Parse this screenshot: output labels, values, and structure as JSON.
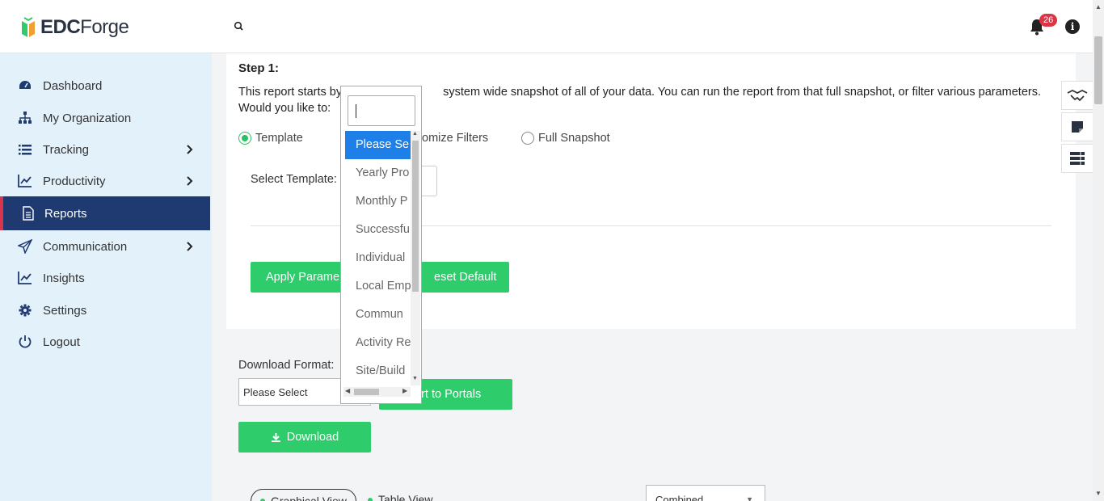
{
  "header": {
    "logo": {
      "part1": "EDC",
      "part2": "Forge"
    },
    "notification_count": "26",
    "info_glyph": "i"
  },
  "sidebar": {
    "items": [
      {
        "label": "Dashboard",
        "icon": "dashboard-icon"
      },
      {
        "label": "My Organization",
        "icon": "sitemap-icon"
      },
      {
        "label": "Tracking",
        "icon": "list-icon",
        "has_submenu": true
      },
      {
        "label": "Productivity",
        "icon": "line-chart-icon",
        "has_submenu": true
      },
      {
        "label": "Reports",
        "icon": "document-icon",
        "active": true
      },
      {
        "label": "Communication",
        "icon": "paper-plane-icon",
        "has_submenu": true
      },
      {
        "label": "Insights",
        "icon": "line-chart-icon"
      },
      {
        "label": "Settings",
        "icon": "gear-icon"
      },
      {
        "label": "Logout",
        "icon": "power-icon"
      }
    ]
  },
  "step": {
    "title": "Step 1:",
    "description_before": "This report starts by",
    "description_after": "system wide snapshot of all of your data. You can run the report from that full snapshot, or filter various parameters.",
    "description_line2": "Would you like to:",
    "options": {
      "template": "Template",
      "customize": "omize Filters",
      "full_snapshot": "Full Snapshot"
    },
    "selected_option": "Template",
    "select_template_label": "Select Template:",
    "apply_button": "Apply Parame",
    "reset_button": "eset Default"
  },
  "download": {
    "format_label": "Download Format:",
    "format_value": "Please Select",
    "export_button": "ort to Portals",
    "download_button": "Download"
  },
  "views": {
    "graphical": "Graphical View",
    "table": "Table View",
    "combined": "Combined"
  },
  "dropdown": {
    "search_value": "",
    "options": [
      {
        "label": "Please Se",
        "selected": true
      },
      {
        "label": "Yearly Pro"
      },
      {
        "label": "Monthly P"
      },
      {
        "label": "Successfu"
      },
      {
        "label": "Individual"
      },
      {
        "label": "Local Emp"
      },
      {
        "label": "Commun"
      },
      {
        "label": "Activity Re"
      },
      {
        "label": "Site/Build"
      }
    ]
  },
  "colors": {
    "accent_green": "#2ecc6b",
    "nav_active": "#1e3a70",
    "nav_active_border": "#d8344b",
    "selected_option": "#1e7fe8",
    "sidebar_bg": "#e3f1fb"
  }
}
